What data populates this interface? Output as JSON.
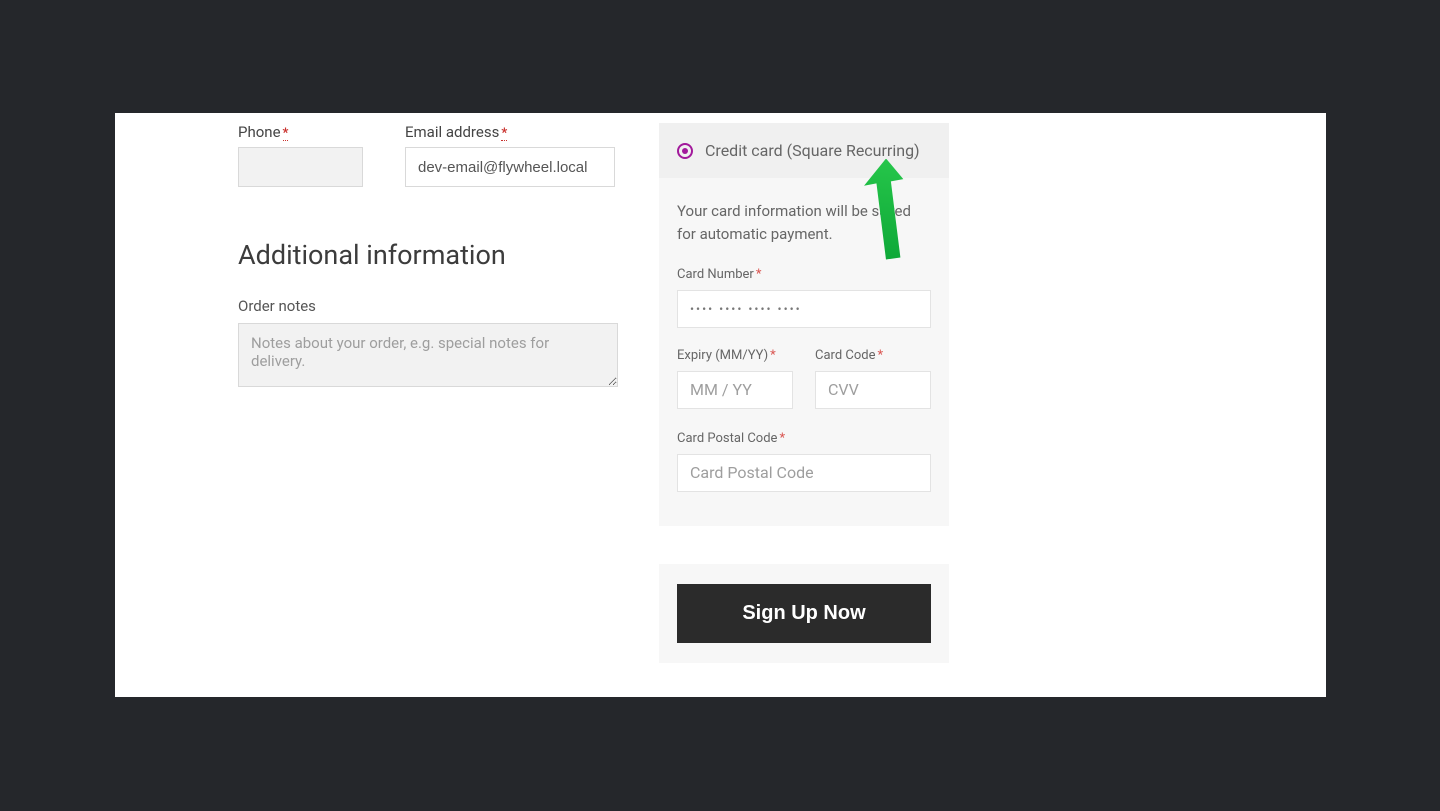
{
  "billing": {
    "phone_label": "Phone",
    "phone_value": "",
    "email_label": "Email address",
    "email_value": "dev-email@flywheel.local"
  },
  "additional": {
    "heading": "Additional information",
    "notes_label": "Order notes",
    "notes_placeholder": "Notes about your order, e.g. special notes for delivery.",
    "notes_value": ""
  },
  "payment": {
    "method_label": "Credit card (Square Recurring)",
    "description": "Your card information will be saved for automatic payment.",
    "card_number_label": "Card Number",
    "card_number_placeholder": "•••• •••• •••• ••••",
    "expiry_label": "Expiry (MM/YY)",
    "expiry_placeholder": "MM / YY",
    "cvv_label": "Card Code",
    "cvv_placeholder": "CVV",
    "postal_label": "Card Postal Code",
    "postal_placeholder": "Card Postal Code"
  },
  "cta": {
    "signup_label": "Sign Up Now"
  }
}
